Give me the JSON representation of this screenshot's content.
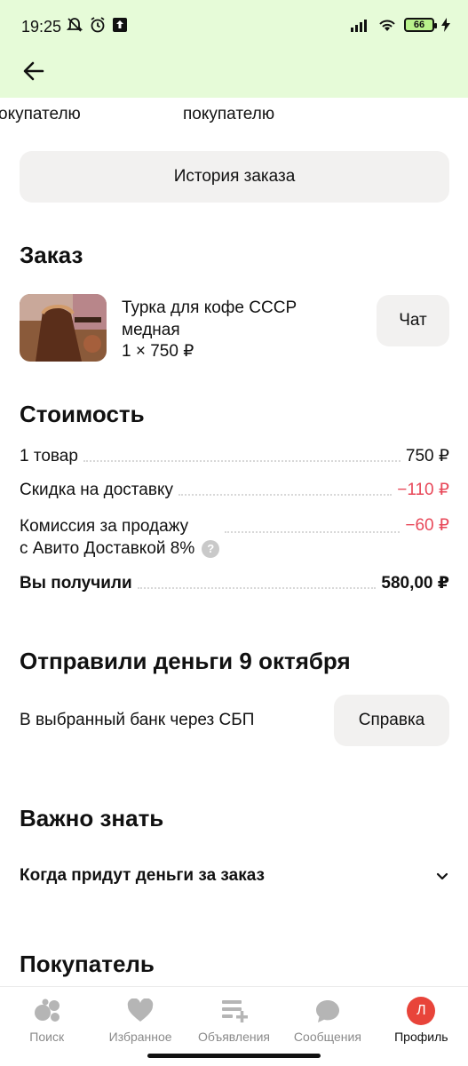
{
  "status": {
    "time": "19:25",
    "battery": "66"
  },
  "header": {
    "peek_left": "окупателю",
    "peek_mid": "покупателю"
  },
  "history_button": "История заказа",
  "order": {
    "heading": "Заказ",
    "item_title": "Турка для кофе СССР медная",
    "item_qty": "1 × 750 ₽",
    "chat_button": "Чат"
  },
  "cost": {
    "heading": "Стоимость",
    "rows": [
      {
        "label": "1 товар",
        "value": "750 ₽"
      },
      {
        "label": "Скидка на доставку",
        "value": "−110 ₽"
      },
      {
        "label_line1": "Комиссия за продажу",
        "label_line2": "с Авито Доставкой 8%",
        "value": "−60 ₽"
      },
      {
        "label": "Вы получили",
        "value": "580,00 ₽"
      }
    ]
  },
  "payout": {
    "heading": "Отправили деньги 9 октября",
    "text": "В выбранный банк через СБП",
    "help_button": "Справка"
  },
  "important": {
    "heading": "Важно знать",
    "faq": "Когда придут деньги за заказ"
  },
  "buyer": {
    "heading": "Покупатель"
  },
  "bottom_nav": {
    "items": [
      {
        "label": "Поиск",
        "icon": "search-bubbles-icon"
      },
      {
        "label": "Избранное",
        "icon": "heart-icon"
      },
      {
        "label": "Объявления",
        "icon": "listings-add-icon"
      },
      {
        "label": "Сообщения",
        "icon": "chat-bubble-icon"
      },
      {
        "label": "Профиль",
        "icon": "avatar",
        "avatar_letter": "Л"
      }
    ]
  },
  "colors": {
    "topbar": "#e6fbd8",
    "negative": "#e8495a",
    "button_bg": "#f2f1f0",
    "avatar": "#e8443a"
  }
}
